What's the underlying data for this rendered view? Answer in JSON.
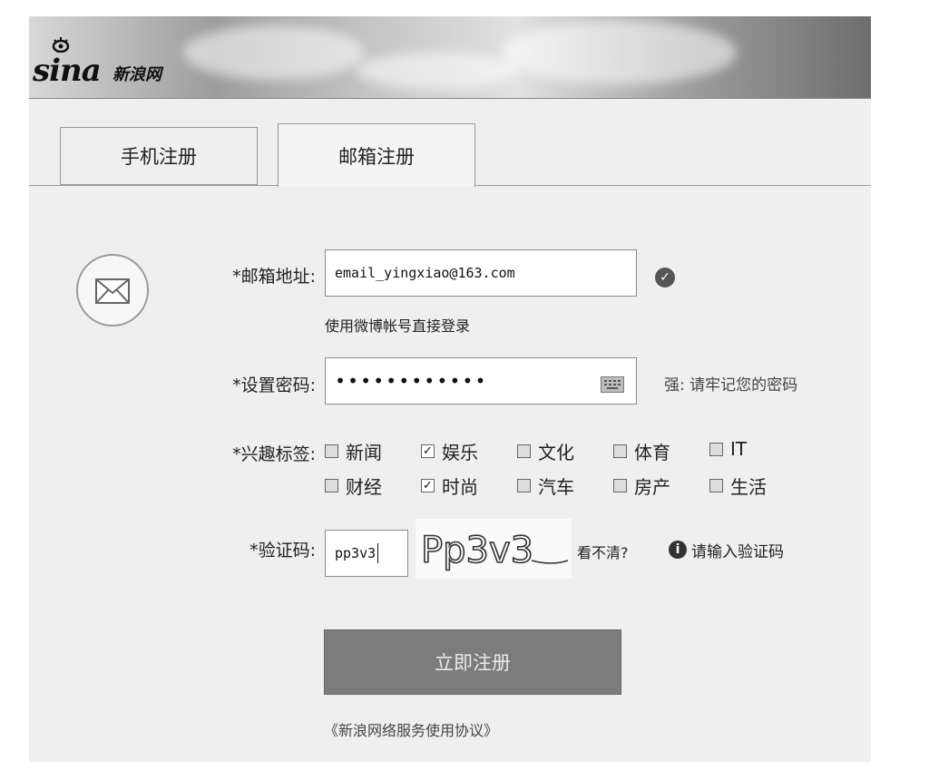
{
  "header": {
    "logo_text": "sina",
    "logo_cn": "新浪网"
  },
  "tabs": [
    {
      "label": "手机注册"
    },
    {
      "label": "邮箱注册"
    }
  ],
  "form": {
    "email": {
      "label": "*邮箱地址:",
      "value": "email_yingxiao@163.com",
      "status_icon": "check-icon",
      "note": "使用微博帐号直接登录"
    },
    "password": {
      "label": "*设置密码:",
      "value": "••••••••••••",
      "keyboard_icon": "keyboard-icon",
      "hint": "强: 请牢记您的密码"
    },
    "interests": {
      "label": "*兴趣标签:",
      "options": [
        {
          "label": "新闻",
          "checked": false
        },
        {
          "label": "娱乐",
          "checked": true
        },
        {
          "label": "文化",
          "checked": false
        },
        {
          "label": "体育",
          "checked": false
        },
        {
          "label": "IT",
          "checked": false
        },
        {
          "label": "财经",
          "checked": false
        },
        {
          "label": "时尚",
          "checked": true
        },
        {
          "label": "汽车",
          "checked": false
        },
        {
          "label": "房产",
          "checked": false
        },
        {
          "label": "生活",
          "checked": false
        }
      ]
    },
    "captcha": {
      "label": "*验证码:",
      "value": "pp3v3",
      "image_text": "Pp3v3",
      "refresh_text": "看不清?",
      "hint": "请输入验证码"
    },
    "submit_label": "立即注册",
    "agreement": "《新浪网络服务使用协议》"
  }
}
